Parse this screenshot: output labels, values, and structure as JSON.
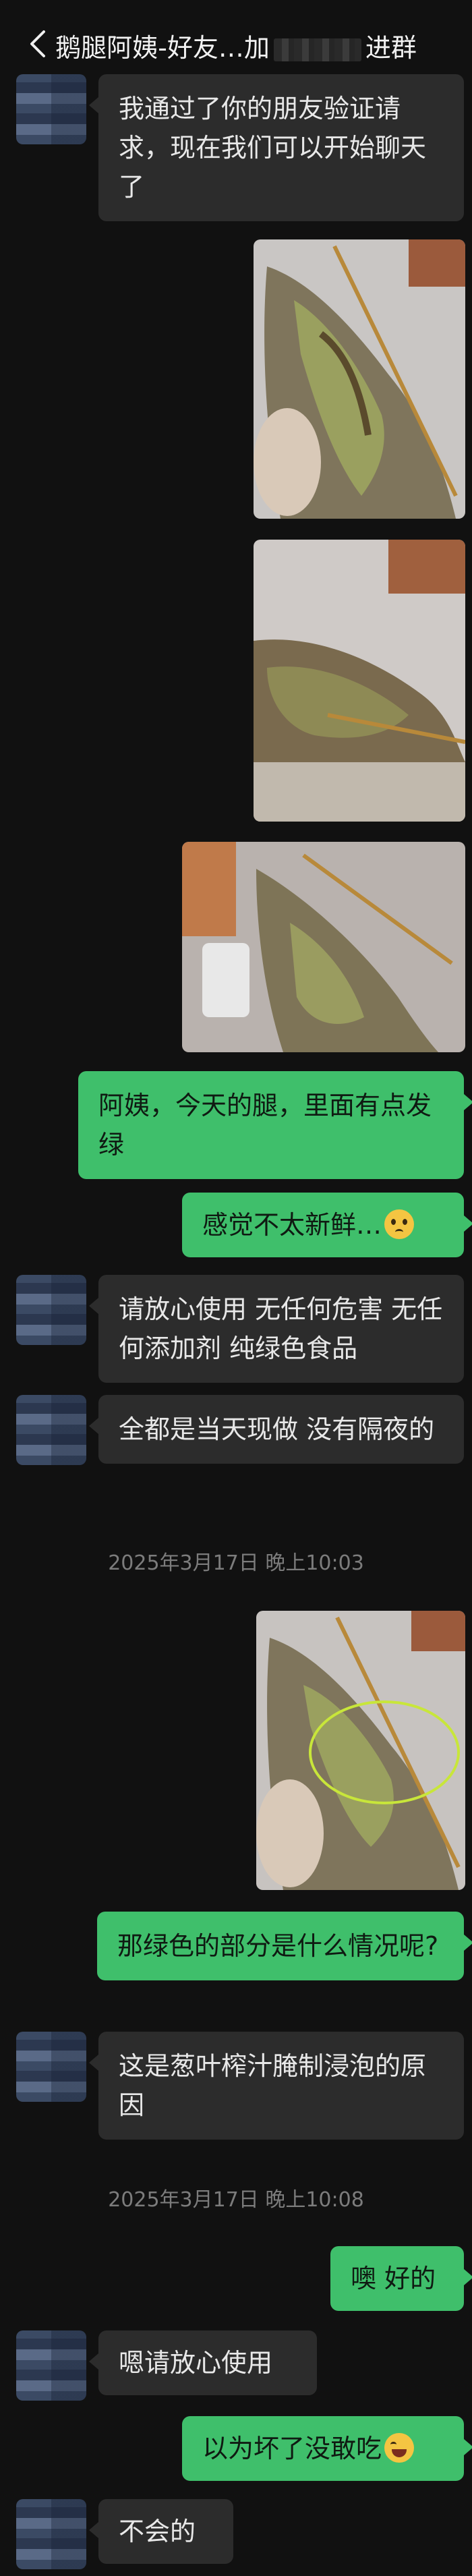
{
  "header": {
    "title_part1": "鹅腿阿姨-好友…加",
    "title_part2": "进群"
  },
  "messages": [
    {
      "text": "我通过了你的朋友验证请求，现在我们可以开始聊天了"
    },
    {
      "text": "阿姨，今天的腿，里面有点发绿"
    },
    {
      "text": "感觉不太新鲜…"
    },
    {
      "text": "请放心使用 无任何危害 无任何添加剂 纯绿色食品"
    },
    {
      "text": "全都是当天现做 没有隔夜的"
    },
    {
      "text": "那绿色的部分是什么情况呢?"
    },
    {
      "text": "这是葱叶榨汁腌制浸泡的原因"
    },
    {
      "text": "噢 好的"
    },
    {
      "text": "嗯请放心使用"
    },
    {
      "text": "以为坏了没敢吃"
    },
    {
      "text": "不会的"
    }
  ],
  "timestamps": [
    "2025年3月17日 晚上10:03",
    "2025年3月17日 晚上10:08"
  ],
  "icons": {
    "back": "chevron-left-icon",
    "emoji_worry": "worried-face-emoji",
    "emoji_laugh": "laughing-face-emoji"
  }
}
